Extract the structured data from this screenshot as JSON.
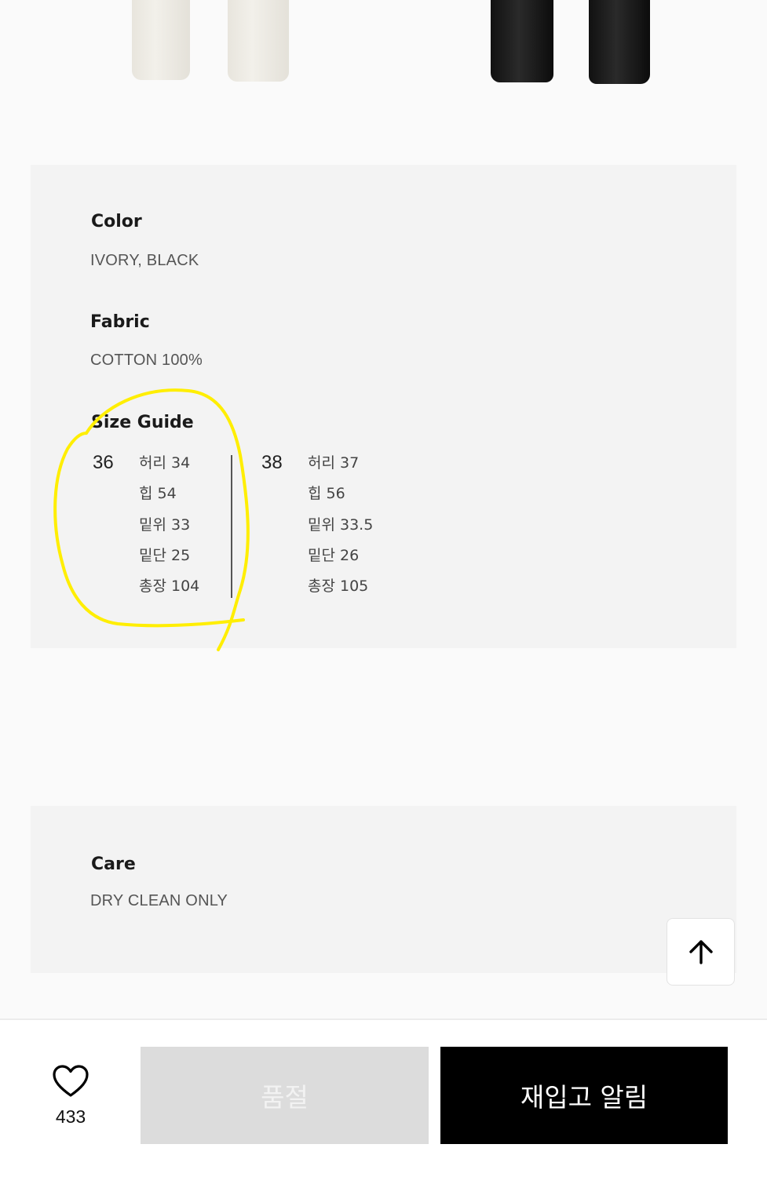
{
  "product_images": [
    {
      "name": "ivory-pants",
      "color": "#efece5"
    },
    {
      "name": "black-pants",
      "color": "#151515"
    }
  ],
  "info": {
    "color": {
      "label": "Color",
      "value": "IVORY, BLACK"
    },
    "fabric": {
      "label": "Fabric",
      "value": "COTTON 100%"
    },
    "size_guide": {
      "label": "Size Guide",
      "sizes": [
        {
          "size": "36",
          "rows": [
            "허리 34",
            "힙 54",
            "밑위  33",
            "밑단 25",
            "총장 104"
          ]
        },
        {
          "size": "38",
          "rows": [
            "허리 37",
            "힙 56",
            "밑위  33.5",
            "밑단 26",
            "총장 105"
          ]
        }
      ]
    }
  },
  "care": {
    "label": "Care",
    "value": "DRY CLEAN ONLY"
  },
  "scroll_top": {
    "icon": "arrow-up-icon"
  },
  "bottom_bar": {
    "like_icon": "heart-icon",
    "like_count": "433",
    "soldout_label": "품절",
    "restock_label": "재입고 알림"
  },
  "colors": {
    "panel_bg": "#f3f3f3",
    "annotation": "#ffee00",
    "soldout_bg": "#dcdcdc",
    "restock_bg": "#000000"
  }
}
